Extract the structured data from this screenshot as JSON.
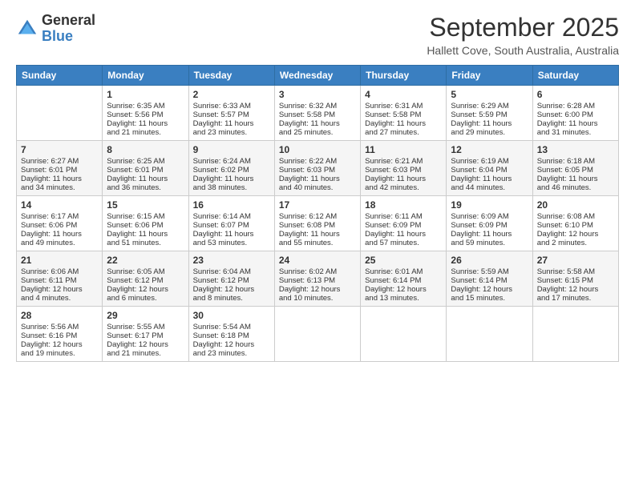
{
  "header": {
    "logo_general": "General",
    "logo_blue": "Blue",
    "month_title": "September 2025",
    "location": "Hallett Cove, South Australia, Australia"
  },
  "days_of_week": [
    "Sunday",
    "Monday",
    "Tuesday",
    "Wednesday",
    "Thursday",
    "Friday",
    "Saturday"
  ],
  "weeks": [
    [
      {
        "day": "",
        "info": ""
      },
      {
        "day": "1",
        "info": "Sunrise: 6:35 AM\nSunset: 5:56 PM\nDaylight: 11 hours\nand 21 minutes."
      },
      {
        "day": "2",
        "info": "Sunrise: 6:33 AM\nSunset: 5:57 PM\nDaylight: 11 hours\nand 23 minutes."
      },
      {
        "day": "3",
        "info": "Sunrise: 6:32 AM\nSunset: 5:58 PM\nDaylight: 11 hours\nand 25 minutes."
      },
      {
        "day": "4",
        "info": "Sunrise: 6:31 AM\nSunset: 5:58 PM\nDaylight: 11 hours\nand 27 minutes."
      },
      {
        "day": "5",
        "info": "Sunrise: 6:29 AM\nSunset: 5:59 PM\nDaylight: 11 hours\nand 29 minutes."
      },
      {
        "day": "6",
        "info": "Sunrise: 6:28 AM\nSunset: 6:00 PM\nDaylight: 11 hours\nand 31 minutes."
      }
    ],
    [
      {
        "day": "7",
        "info": "Sunrise: 6:27 AM\nSunset: 6:01 PM\nDaylight: 11 hours\nand 34 minutes."
      },
      {
        "day": "8",
        "info": "Sunrise: 6:25 AM\nSunset: 6:01 PM\nDaylight: 11 hours\nand 36 minutes."
      },
      {
        "day": "9",
        "info": "Sunrise: 6:24 AM\nSunset: 6:02 PM\nDaylight: 11 hours\nand 38 minutes."
      },
      {
        "day": "10",
        "info": "Sunrise: 6:22 AM\nSunset: 6:03 PM\nDaylight: 11 hours\nand 40 minutes."
      },
      {
        "day": "11",
        "info": "Sunrise: 6:21 AM\nSunset: 6:03 PM\nDaylight: 11 hours\nand 42 minutes."
      },
      {
        "day": "12",
        "info": "Sunrise: 6:19 AM\nSunset: 6:04 PM\nDaylight: 11 hours\nand 44 minutes."
      },
      {
        "day": "13",
        "info": "Sunrise: 6:18 AM\nSunset: 6:05 PM\nDaylight: 11 hours\nand 46 minutes."
      }
    ],
    [
      {
        "day": "14",
        "info": "Sunrise: 6:17 AM\nSunset: 6:06 PM\nDaylight: 11 hours\nand 49 minutes."
      },
      {
        "day": "15",
        "info": "Sunrise: 6:15 AM\nSunset: 6:06 PM\nDaylight: 11 hours\nand 51 minutes."
      },
      {
        "day": "16",
        "info": "Sunrise: 6:14 AM\nSunset: 6:07 PM\nDaylight: 11 hours\nand 53 minutes."
      },
      {
        "day": "17",
        "info": "Sunrise: 6:12 AM\nSunset: 6:08 PM\nDaylight: 11 hours\nand 55 minutes."
      },
      {
        "day": "18",
        "info": "Sunrise: 6:11 AM\nSunset: 6:09 PM\nDaylight: 11 hours\nand 57 minutes."
      },
      {
        "day": "19",
        "info": "Sunrise: 6:09 AM\nSunset: 6:09 PM\nDaylight: 11 hours\nand 59 minutes."
      },
      {
        "day": "20",
        "info": "Sunrise: 6:08 AM\nSunset: 6:10 PM\nDaylight: 12 hours\nand 2 minutes."
      }
    ],
    [
      {
        "day": "21",
        "info": "Sunrise: 6:06 AM\nSunset: 6:11 PM\nDaylight: 12 hours\nand 4 minutes."
      },
      {
        "day": "22",
        "info": "Sunrise: 6:05 AM\nSunset: 6:12 PM\nDaylight: 12 hours\nand 6 minutes."
      },
      {
        "day": "23",
        "info": "Sunrise: 6:04 AM\nSunset: 6:12 PM\nDaylight: 12 hours\nand 8 minutes."
      },
      {
        "day": "24",
        "info": "Sunrise: 6:02 AM\nSunset: 6:13 PM\nDaylight: 12 hours\nand 10 minutes."
      },
      {
        "day": "25",
        "info": "Sunrise: 6:01 AM\nSunset: 6:14 PM\nDaylight: 12 hours\nand 13 minutes."
      },
      {
        "day": "26",
        "info": "Sunrise: 5:59 AM\nSunset: 6:14 PM\nDaylight: 12 hours\nand 15 minutes."
      },
      {
        "day": "27",
        "info": "Sunrise: 5:58 AM\nSunset: 6:15 PM\nDaylight: 12 hours\nand 17 minutes."
      }
    ],
    [
      {
        "day": "28",
        "info": "Sunrise: 5:56 AM\nSunset: 6:16 PM\nDaylight: 12 hours\nand 19 minutes."
      },
      {
        "day": "29",
        "info": "Sunrise: 5:55 AM\nSunset: 6:17 PM\nDaylight: 12 hours\nand 21 minutes."
      },
      {
        "day": "30",
        "info": "Sunrise: 5:54 AM\nSunset: 6:18 PM\nDaylight: 12 hours\nand 23 minutes."
      },
      {
        "day": "",
        "info": ""
      },
      {
        "day": "",
        "info": ""
      },
      {
        "day": "",
        "info": ""
      },
      {
        "day": "",
        "info": ""
      }
    ]
  ]
}
